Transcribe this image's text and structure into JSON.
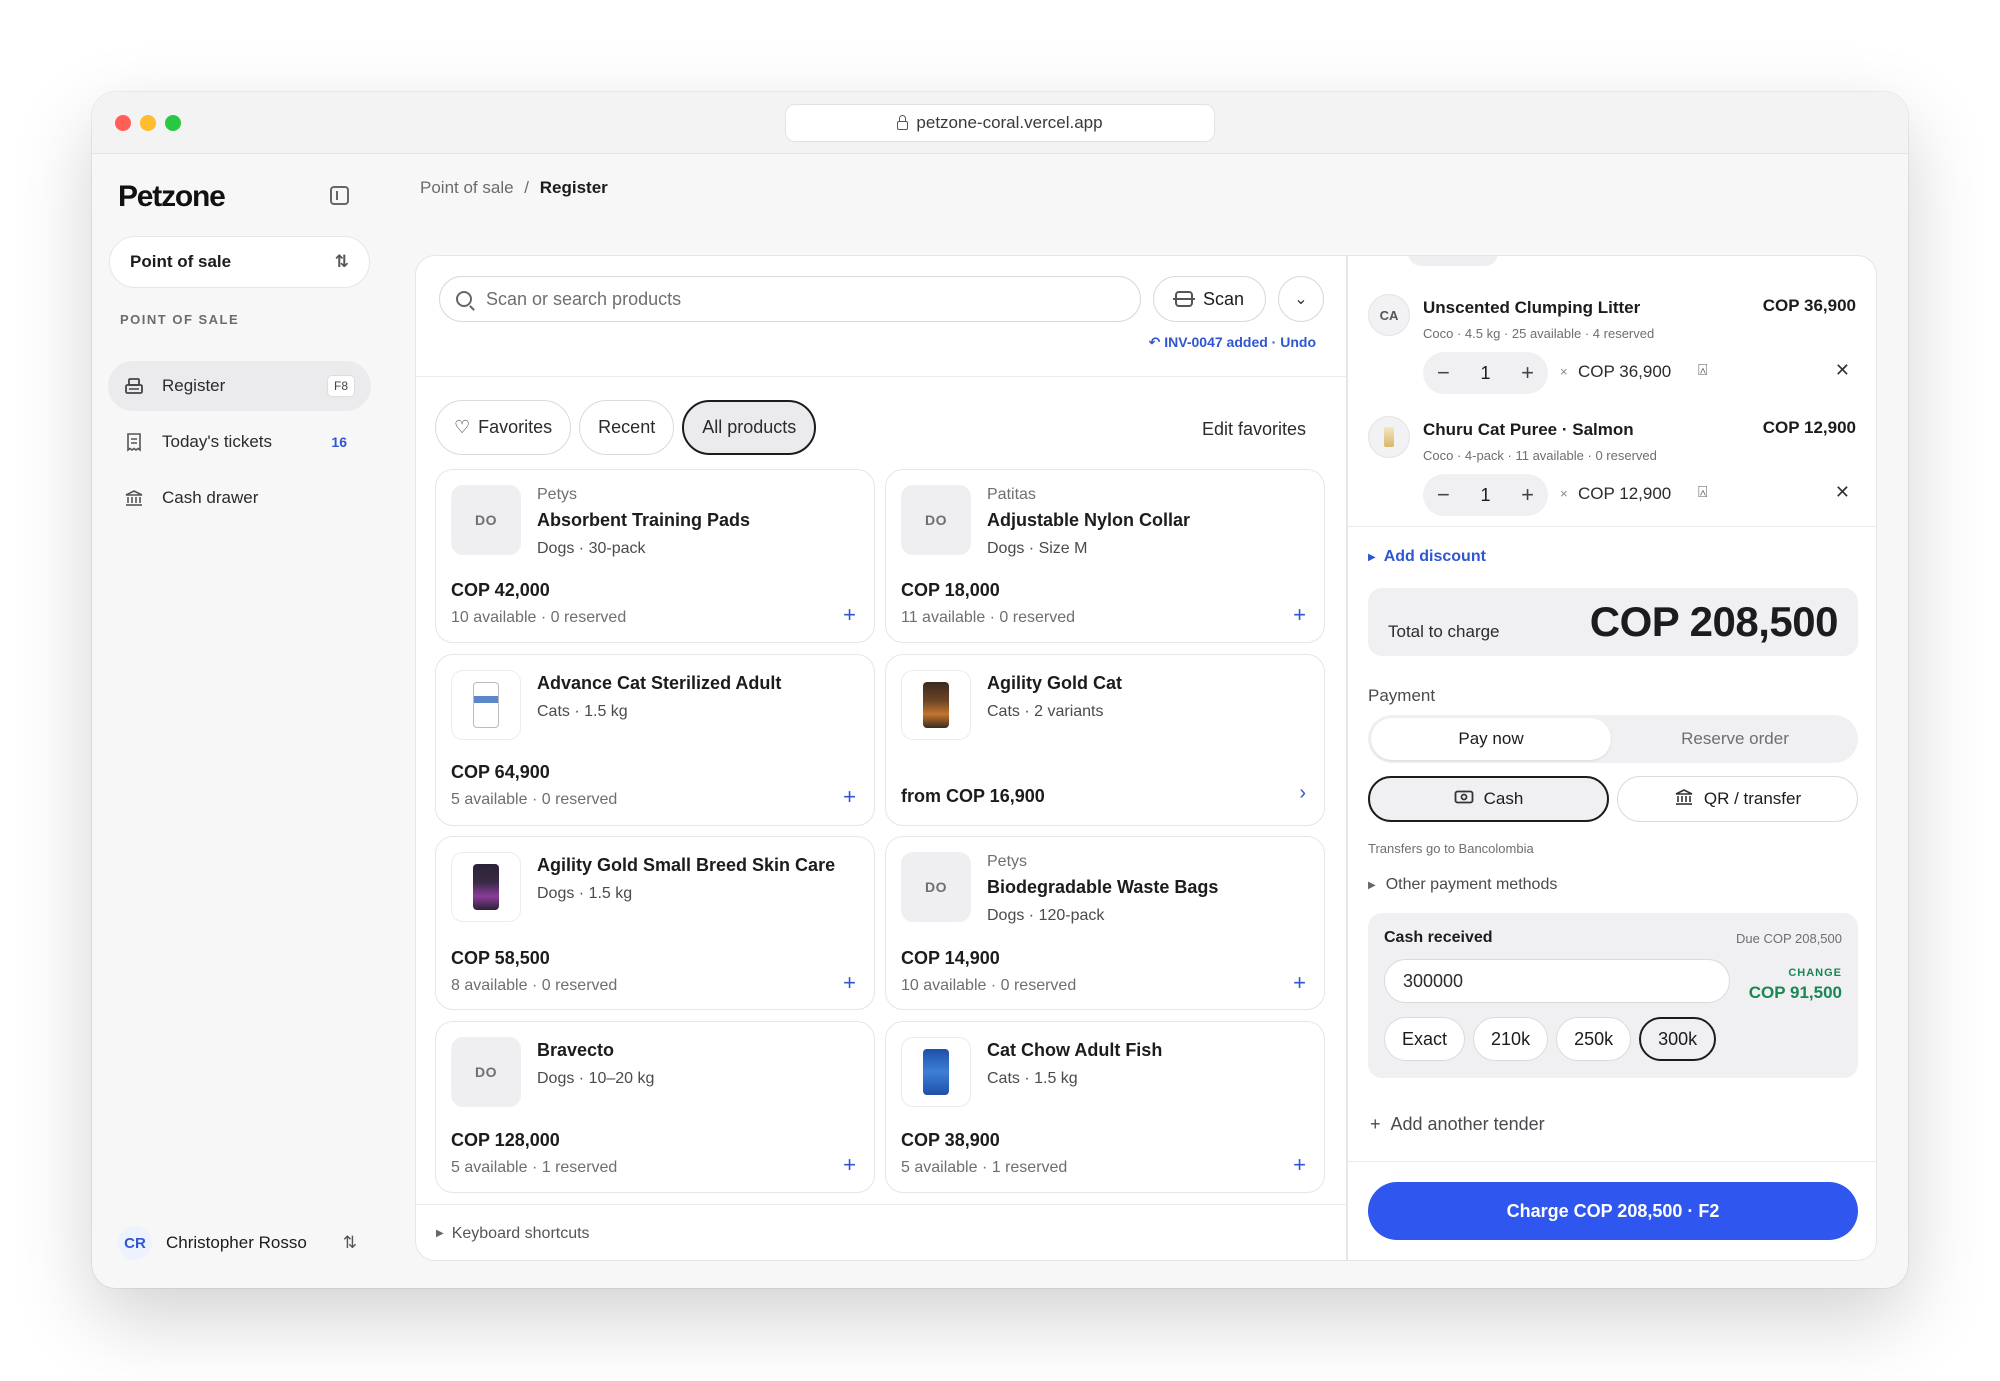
{
  "browser": {
    "url": "petzone-coral.vercel.app"
  },
  "sidebar": {
    "logo": "Petzone",
    "app_switcher": "Point of sale",
    "section_label": "POINT OF SALE",
    "items": [
      {
        "label": "Register",
        "shortcut": "F8",
        "icon": "register-icon",
        "active": true
      },
      {
        "label": "Today's tickets",
        "count": "16",
        "icon": "receipt-icon"
      },
      {
        "label": "Cash drawer",
        "icon": "bank-icon"
      }
    ],
    "user": {
      "initials": "CR",
      "name": "Christopher Rosso"
    }
  },
  "breadcrumb": {
    "parent": "Point of sale",
    "separator": "/",
    "current": "Register"
  },
  "catalog": {
    "search_placeholder": "Scan or search products",
    "scan_label": "Scan",
    "toast": "INV-0047 added · Undo",
    "tabs": [
      {
        "label": "Favorites",
        "icon": "heart-icon"
      },
      {
        "label": "Recent"
      },
      {
        "label": "All products",
        "active": true
      }
    ],
    "edit_favorites": "Edit favorites",
    "products": [
      {
        "brand": "Petys",
        "name": "Absorbent Training Pads",
        "meta": "Dogs · 30-pack",
        "price": "COP 42,000",
        "stock": "10 available · 0 reserved",
        "thumb": "DO"
      },
      {
        "brand": "Patitas",
        "name": "Adjustable Nylon Collar",
        "meta": "Dogs · Size M",
        "price": "COP 18,000",
        "stock": "11 available · 0 reserved",
        "thumb": "DO"
      },
      {
        "brand": "",
        "name": "Advance Cat Sterilized Adult",
        "meta": "Cats · 1.5 kg",
        "price": "COP 64,900",
        "stock": "5 available · 0 reserved",
        "thumb": ""
      },
      {
        "brand": "",
        "name": "Agility Gold Cat",
        "meta": "Cats · 2 variants",
        "price": "from COP 16,900",
        "stock": "",
        "thumb": ""
      },
      {
        "brand": "",
        "name": "Agility Gold Small Breed Skin Care",
        "meta": "Dogs · 1.5 kg",
        "price": "COP 58,500",
        "stock": "8 available · 0 reserved",
        "thumb": ""
      },
      {
        "brand": "Petys",
        "name": "Biodegradable Waste Bags",
        "meta": "Dogs · 120-pack",
        "price": "COP 14,900",
        "stock": "10 available · 0 reserved",
        "thumb": "DO"
      },
      {
        "brand": "",
        "name": "Bravecto",
        "meta": "Dogs · 10–20 kg",
        "price": "COP 128,000",
        "stock": "5 available · 1 reserved",
        "thumb": "DO"
      },
      {
        "brand": "",
        "name": "Cat Chow Adult Fish",
        "meta": "Cats · 1.5 kg",
        "price": "COP 38,900",
        "stock": "5 available · 1 reserved",
        "thumb": ""
      }
    ],
    "keyboard_shortcuts": "Keyboard shortcuts"
  },
  "cart": {
    "lines": [
      {
        "thumb": "CA",
        "name": "Unscented Clumping Litter",
        "meta": "Coco · 4.5 kg · 25 available · 4 reserved",
        "price": "COP 36,900",
        "qty": "1",
        "line_total": "COP 36,900"
      },
      {
        "thumb": "",
        "name": "Churu Cat Puree · Salmon",
        "meta": "Coco · 4-pack · 11 available · 0 reserved",
        "price": "COP 12,900",
        "qty": "1",
        "line_total": "COP 12,900"
      }
    ],
    "add_discount": "Add discount",
    "total_label": "Total to charge",
    "total_value": "COP 208,500",
    "payment_label": "Payment",
    "pay_now": "Pay now",
    "reserve_order": "Reserve order",
    "method_cash": "Cash",
    "method_qr": "QR / transfer",
    "transfer_hint": "Transfers go to Bancolombia",
    "other_methods": "Other payment methods",
    "cash_received_label": "Cash received",
    "due": "Due COP 208,500",
    "cash_input_value": "300000",
    "change_label": "CHANGE",
    "change_value": "COP 91,500",
    "quick_amounts": [
      "Exact",
      "210k",
      "250k",
      "300k"
    ],
    "add_tender": "Add another tender",
    "charge_button": "Charge COP 208,500  · F2"
  },
  "colors": {
    "accent": "#2f56ee",
    "change": "#198754",
    "link": "#2f56d3"
  }
}
